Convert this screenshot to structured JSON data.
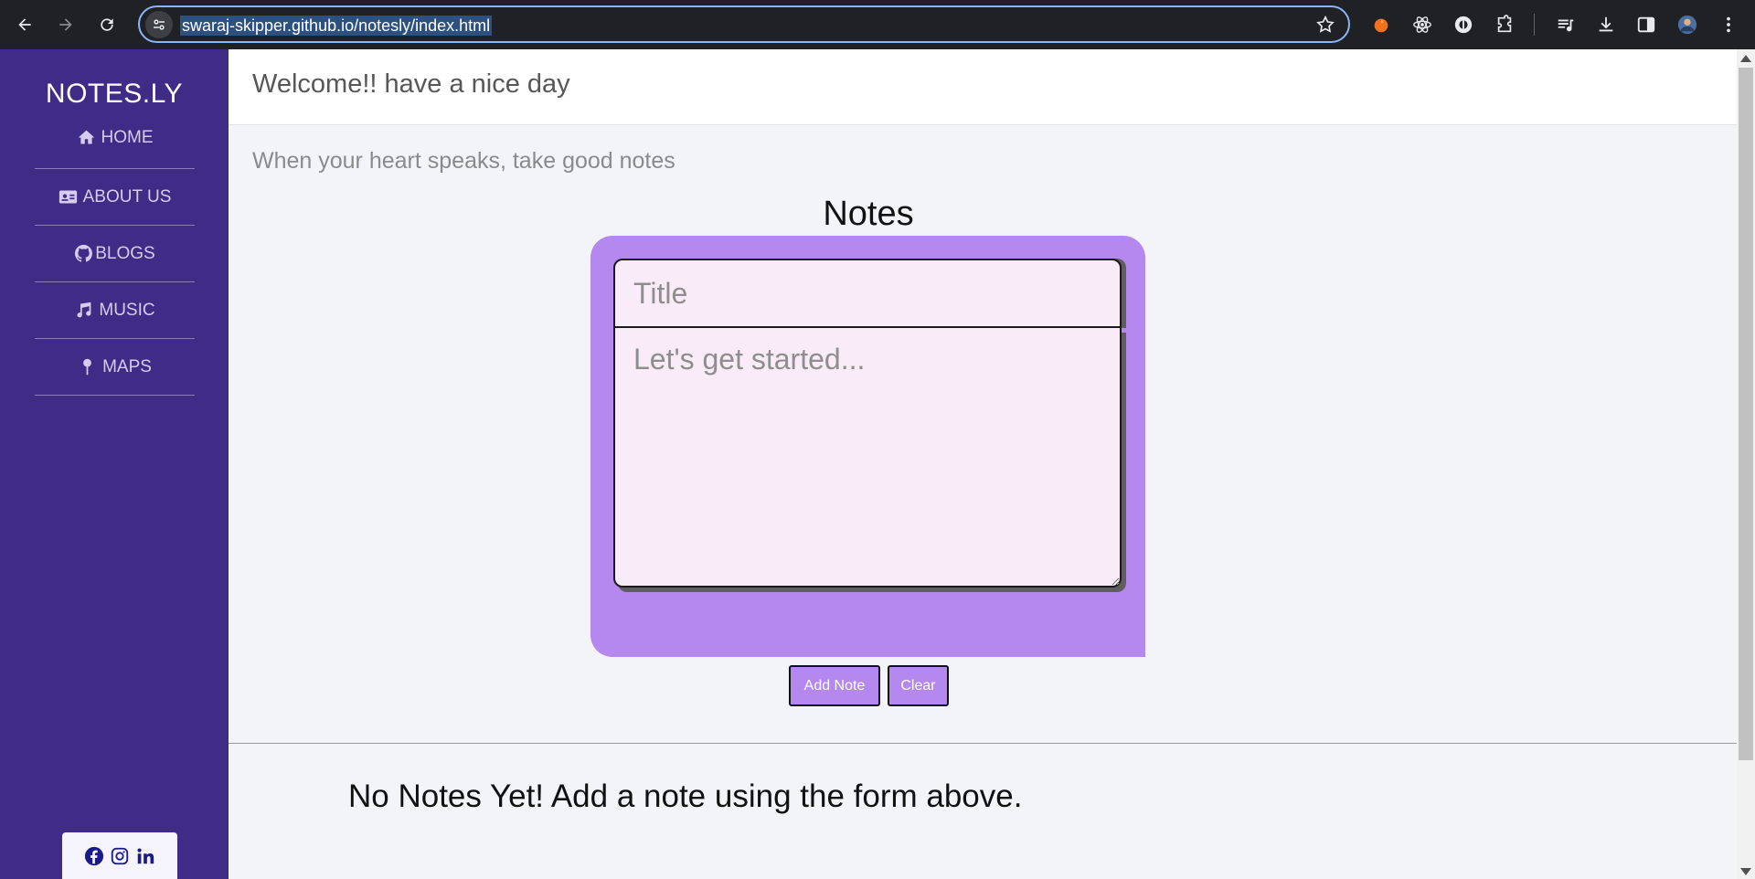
{
  "browser": {
    "url": "swaraj-skipper.github.io/notesly/index.html",
    "icons": [
      "back-icon",
      "forward-icon",
      "reload-icon",
      "site-settings-icon",
      "bookmark-star-icon",
      "extension-icons",
      "puzzle-extensions-icon",
      "media-queue-icon",
      "download-icon",
      "side-panel-icon",
      "profile-avatar",
      "kebab-menu-icon"
    ]
  },
  "sidebar": {
    "brand": "NOTES.LY",
    "items": [
      {
        "label": "HOME",
        "icon": "home-icon"
      },
      {
        "label": "ABOUT US",
        "icon": "id-card-icon"
      },
      {
        "label": "BLOGS",
        "icon": "github-icon"
      },
      {
        "label": "MUSIC",
        "icon": "music-note-icon"
      },
      {
        "label": "MAPS",
        "icon": "map-pin-icon"
      }
    ],
    "social": [
      "facebook-icon",
      "instagram-icon",
      "linkedin-icon"
    ]
  },
  "header": {
    "welcome": "Welcome!! have a nice day"
  },
  "main": {
    "tagline": "When your heart speaks, take good notes",
    "heading": "Notes",
    "title_placeholder": "Title",
    "body_placeholder": "Let's get started...",
    "add_label": "Add Note",
    "clear_label": "Clear",
    "empty_message": "No Notes Yet! Add a note using the form above."
  },
  "colors": {
    "sidebar": "#3f2c87",
    "accent": "#b588f0",
    "input_bg": "#f9ebf8"
  }
}
